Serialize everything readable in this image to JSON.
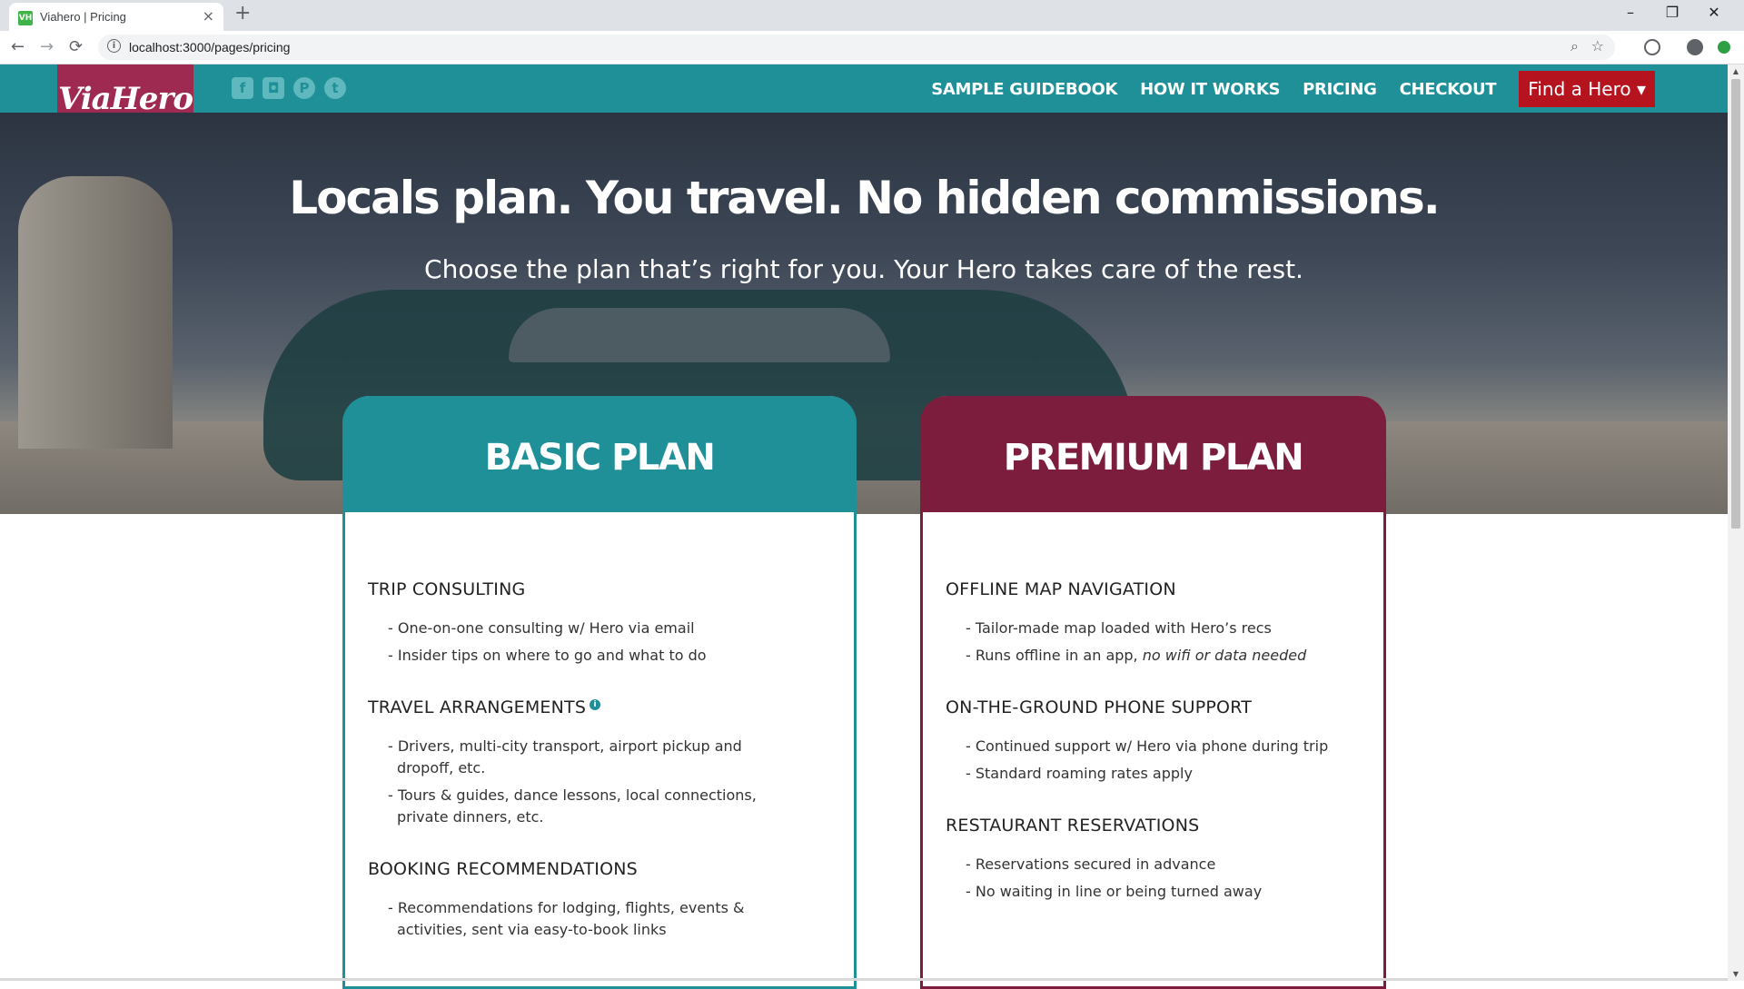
{
  "browser": {
    "tab_title": "Viahero | Pricing",
    "favicon_text": "VH",
    "tab_close": "×",
    "new_tab": "+",
    "url": "localhost:3000/pages/pricing",
    "back": "←",
    "forward": "→",
    "reload": "⟳",
    "zoom": "⌕",
    "star": "☆",
    "min": "–",
    "restore": "❐",
    "close": "✕"
  },
  "header": {
    "logo": "ViaHero",
    "social": [
      {
        "icon": "facebook-icon",
        "glyph": "f"
      },
      {
        "icon": "instagram-icon",
        "glyph": "◘"
      },
      {
        "icon": "pinterest-icon",
        "glyph": "P"
      },
      {
        "icon": "twitter-icon",
        "glyph": "t"
      }
    ],
    "nav": [
      "SAMPLE GUIDEBOOK",
      "HOW IT WORKS",
      "PRICING",
      "CHECKOUT"
    ],
    "cta": "Find a Hero ▾",
    "colors": {
      "teal": "#1f8f98",
      "logo": "#9f2a51",
      "cta": "#b5141f"
    }
  },
  "hero": {
    "title": "Locals plan. You travel. No hidden commissions.",
    "subtitle": "Choose the plan that’s right for you. Your Hero takes care of the rest."
  },
  "plans": {
    "basic": {
      "title": "BASIC PLAN",
      "features": [
        {
          "title": "TRIP CONSULTING",
          "items": [
            "- One-on-one consulting w/ Hero via email",
            "- Insider tips on where to go and what to do"
          ]
        },
        {
          "title": "TRAVEL ARRANGEMENTS",
          "info": "i",
          "items": [
            "- Drivers, multi-city transport, airport pickup and dropoff, etc.",
            "- Tours & guides, dance lessons, local connections, private dinners, etc."
          ]
        },
        {
          "title": "BOOKING RECOMMENDATIONS",
          "items": [
            "- Recommendations for lodging, flights, events & activities, sent via easy-to-book links"
          ]
        }
      ]
    },
    "premium": {
      "title": "PREMIUM PLAN",
      "features": [
        {
          "title": "OFFLINE MAP NAVIGATION",
          "items": [
            "- Tailor-made map loaded with Hero’s recs",
            "- Runs offline in an app, "
          ],
          "italic": "no wifi or data needed"
        },
        {
          "title": "ON-THE-GROUND PHONE SUPPORT",
          "items": [
            "- Continued support w/ Hero via phone during trip",
            "- Standard roaming rates apply"
          ]
        },
        {
          "title": "RESTAURANT RESERVATIONS",
          "items": [
            "- Reservations secured in advance",
            "- No waiting in line or being turned away"
          ]
        }
      ]
    },
    "colors": {
      "basic": "#1f8f98",
      "premium": "#7d1d3e"
    }
  }
}
